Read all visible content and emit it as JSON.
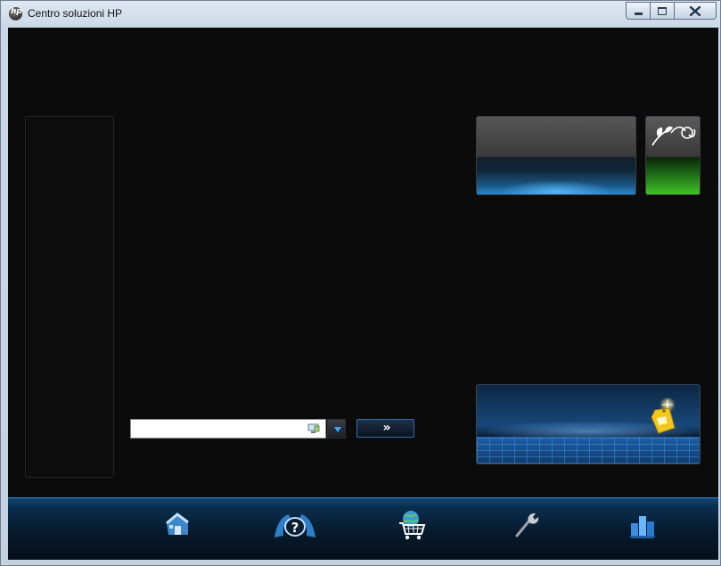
{
  "window": {
    "title": "Centro soluzioni HP",
    "app_icon": "hp-logo-icon"
  },
  "window_controls": {
    "minimize_icon": "minimize-icon",
    "maximize_icon": "maximize-icon",
    "close_icon": "close-icon"
  },
  "colors": {
    "client_background": "#0b0b0c",
    "accent_blue": "#2a82c7",
    "accent_green": "#3fbf26",
    "nav_bar": "#0a2e4e"
  },
  "search": {
    "value": "",
    "placeholder": "",
    "search_icon": "search-monitor-icon",
    "dropdown_icon": "chevron-down-icon",
    "go_label": "»",
    "go_icon": "double-chevron-right-icon"
  },
  "tiles": {
    "blue_tile_icon": "blank-tile",
    "green_tile_icon": "hp-eco-leaf-icon",
    "promo_tile_icon": "price-tag-icon"
  },
  "nav": {
    "items": [
      {
        "id": "home",
        "icon": "home-icon"
      },
      {
        "id": "help",
        "icon": "help-icon"
      },
      {
        "id": "shop",
        "icon": "shopping-cart-globe-icon"
      },
      {
        "id": "tools",
        "icon": "wrench-icon"
      },
      {
        "id": "status",
        "icon": "bar-chart-icon"
      }
    ]
  }
}
